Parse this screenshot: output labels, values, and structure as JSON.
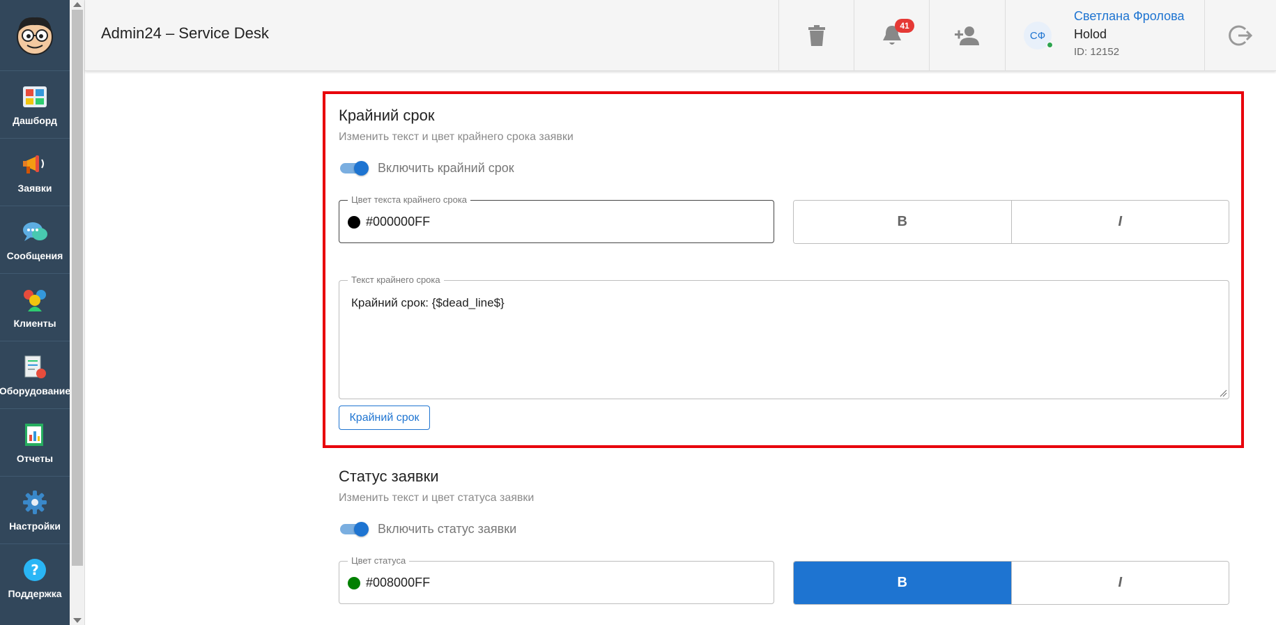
{
  "header": {
    "app_title": "Admin24 – Service Desk",
    "notifications_count": "41",
    "user": {
      "initials": "СФ",
      "name": "Светлана Фролова",
      "org": "Holod",
      "id": "ID: 12152"
    },
    "icons": [
      "trash-icon",
      "bell-icon",
      "add-user-icon",
      "logout-icon"
    ]
  },
  "sidebar": {
    "items": [
      {
        "label": "Дашборд",
        "icon": "dashboard-icon"
      },
      {
        "label": "Заявки",
        "icon": "megaphone-icon"
      },
      {
        "label": "Сообщения",
        "icon": "chat-icon"
      },
      {
        "label": "Клиенты",
        "icon": "clients-icon"
      },
      {
        "label": "Оборудование",
        "icon": "equipment-icon"
      },
      {
        "label": "Отчеты",
        "icon": "reports-icon"
      },
      {
        "label": "Настройки",
        "icon": "gear-icon"
      },
      {
        "label": "Поддержка",
        "icon": "help-icon"
      }
    ]
  },
  "deadline_section": {
    "title": "Крайний срок",
    "subtitle": "Изменить текст и цвет крайнего срока заявки",
    "toggle_label": "Включить крайний срок",
    "toggle_on": true,
    "color_field": {
      "label": "Цвет текста крайнего срока",
      "value": "#000000FF",
      "dot_color": "#000000"
    },
    "bold_label": "B",
    "italic_label": "I",
    "bold_active": false,
    "text_field": {
      "label": "Текст крайнего срока",
      "value": "Крайний срок: {$dead_line$}"
    },
    "insert_button": "Крайний срок"
  },
  "status_section": {
    "title": "Статус заявки",
    "subtitle": "Изменить текст и цвет статуса заявки",
    "toggle_label": "Включить статус заявки",
    "toggle_on": true,
    "color_field": {
      "label": "Цвет статуса",
      "value": "#008000FF",
      "dot_color": "#008000"
    },
    "bold_label": "B",
    "italic_label": "I",
    "bold_active": true
  },
  "colors": {
    "sidebar_bg": "#32475b",
    "accent": "#1e74d1",
    "highlight_border": "#e8000b",
    "badge": "#e53935"
  }
}
